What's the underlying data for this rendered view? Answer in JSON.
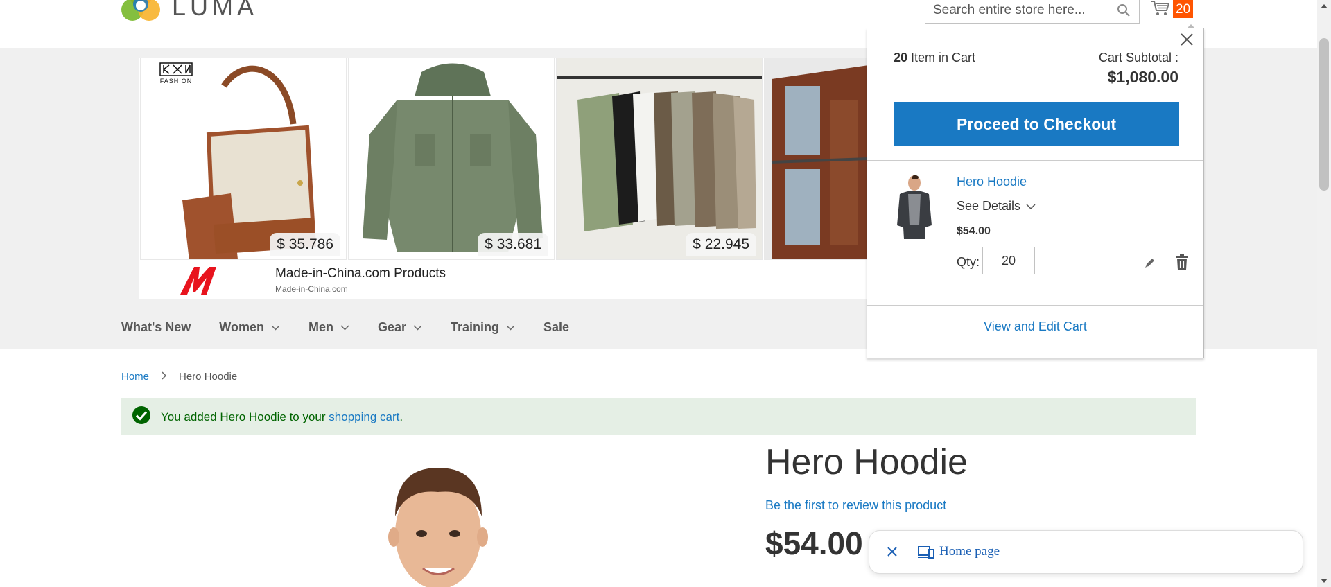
{
  "header": {
    "logo_text": "LUMA",
    "search_placeholder": "Search entire store here...",
    "cart_count": "20"
  },
  "ad": {
    "brand_mark": "FASHION",
    "cards": [
      {
        "price": "$ 35.786"
      },
      {
        "price": "$ 33.681"
      },
      {
        "price": "$ 22.945"
      },
      {
        "price": ""
      }
    ],
    "title": "Made-in-China.com Products",
    "subtitle": "Made-in-China.com"
  },
  "nav": {
    "items": [
      {
        "label": "What's New",
        "has_dropdown": false
      },
      {
        "label": "Women",
        "has_dropdown": true
      },
      {
        "label": "Men",
        "has_dropdown": true
      },
      {
        "label": "Gear",
        "has_dropdown": true
      },
      {
        "label": "Training",
        "has_dropdown": true
      },
      {
        "label": "Sale",
        "has_dropdown": false
      }
    ]
  },
  "breadcrumb": {
    "home": "Home",
    "current": "Hero Hoodie"
  },
  "message": {
    "prefix": "You added Hero Hoodie to your ",
    "link": "shopping cart",
    "suffix": "."
  },
  "product": {
    "title": "Hero Hoodie",
    "review_link": "Be the first to review this product",
    "price": "$54.00"
  },
  "minicart": {
    "count": "20",
    "count_label": " Item in Cart",
    "subtotal_label": "Cart Subtotal :",
    "subtotal": "$1,080.00",
    "checkout_label": "Proceed to Checkout",
    "item": {
      "name": "Hero Hoodie",
      "details_label": "See Details",
      "price": "$54.00",
      "qty_label": "Qty:",
      "qty": "20"
    },
    "view_cart_label": "View and Edit Cart"
  },
  "float_bar": {
    "label": "Home page"
  },
  "colors": {
    "accent": "#1979c3",
    "cart_badge": "#ff5501",
    "success_bg": "#e5efe5",
    "success_text": "#006400"
  }
}
